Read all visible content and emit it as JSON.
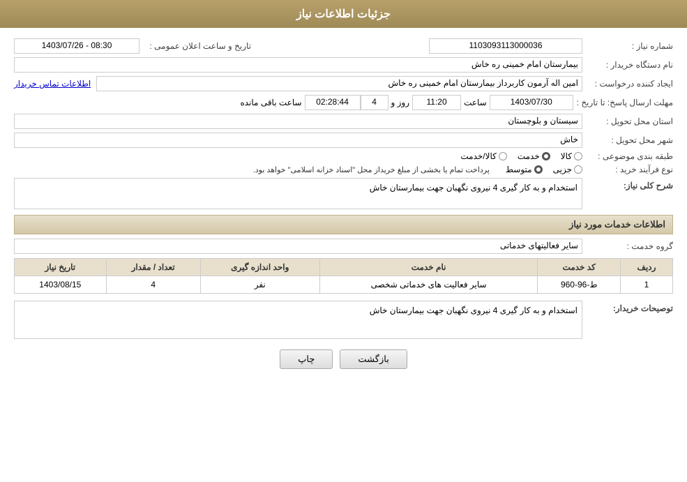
{
  "header": {
    "title": "جزئیات اطلاعات نیاز"
  },
  "form": {
    "shomareNiaz_label": "شماره نیاز :",
    "shomareNiaz_value": "1103093113000036",
    "tarikh_label": "تاریخ و ساعت اعلان عمومی :",
    "tarikh_value": "1403/07/26 - 08:30",
    "namDastgah_label": "نام دستگاه خریدار :",
    "namDastgah_value": "بیمارستان امام خمینی  ره  خاش",
    "ijadKonnande_label": "ایجاد کننده درخواست :",
    "ijadKonnande_value": "امین اله آرمون کاربرداز بیمارستان امام خمینی  ره  خاش",
    "ettelaatTamas_link": "اطلاعات تماس خریدار",
    "mohlatErsalPasokh_label": "مهلت ارسال پاسخ: تا تاریخ :",
    "mohlatErsalDate": "1403/07/30",
    "mohlatErsalSaat_label": "ساعت",
    "mohlatErsalSaat": "11:20",
    "mohlatErsalRoz_label": "روز و",
    "mohlatErsalRoz": "4",
    "mohlatErsalSaatMande_label": "ساعت باقی مانده",
    "mohlatErsalSaatMande": "02:28:44",
    "ostan_label": "استان محل تحویل :",
    "ostan_value": "سیستان و بلوچستان",
    "shahr_label": "شهر محل تحویل :",
    "shahr_value": "خاش",
    "tabaqeBandi_label": "طبقه بندی موضوعی :",
    "tabaqeBandiOptions": [
      {
        "label": "کالا",
        "selected": false
      },
      {
        "label": "خدمت",
        "selected": true
      },
      {
        "label": "کالا/خدمت",
        "selected": false
      }
    ],
    "noeFarayand_label": "نوع فرآیند خرید :",
    "noeFarayandOptions": [
      {
        "label": "جزیی",
        "selected": false
      },
      {
        "label": "متوسط",
        "selected": true
      }
    ],
    "noeFarayandNote": "پرداخت تمام یا بخشی از مبلغ خریداز محل \"اسناد خزانه اسلامی\" خواهد بود.",
    "sharhKolliNiaz_label": "شرح کلی نیاز:",
    "sharhKolliNiaz_value": "استخدام و به کار گیری 4 نیروی نگهبان جهت بیمارستان خاش",
    "ettelaatKhadamat_title": "اطلاعات خدمات مورد نیاز",
    "grohKhadamat_label": "گروه خدمت :",
    "grohKhadamat_value": "سایر فعالیتهای خدماتی",
    "table": {
      "headers": [
        "ردیف",
        "کد خدمت",
        "نام خدمت",
        "واحد اندازه گیری",
        "تعداد / مقدار",
        "تاریخ نیاز"
      ],
      "rows": [
        {
          "radif": "1",
          "kodKhadamat": "ط-96-960",
          "namKhadamat": "سایر فعالیت های خدماتی شخصی",
          "vahed": "نفر",
          "tedad": "4",
          "tarikNiaz": "1403/08/15"
        }
      ]
    },
    "tosifatKharidar_label": "توصیحات خریدار:",
    "tosifatKharidar_value": "استخدام و به کار گیری 4 نیروی نگهبان جهت بیمارستان خاش",
    "btn_chap": "چاپ",
    "btn_bazgasht": "بازگشت"
  }
}
